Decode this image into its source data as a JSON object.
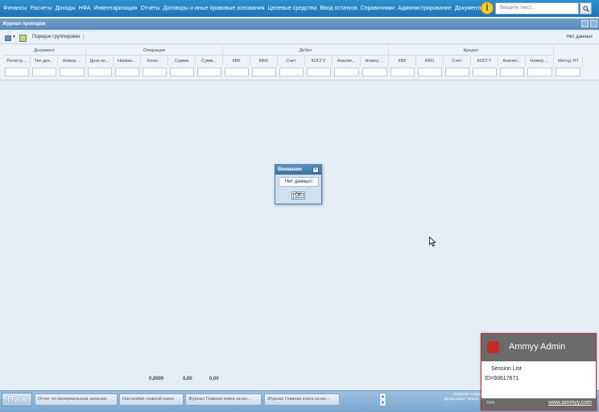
{
  "top_menu": [
    "Финансы",
    "Расчеты",
    "Доходы",
    "НФА",
    "Инвентаризация",
    "Отчеты",
    "Договоры и иные правовые основания",
    "Целевые средства",
    "Ввод остатков",
    "Справочники",
    "Администрирование",
    "Документы"
  ],
  "search": {
    "placeholder": "Введите текст..."
  },
  "window": {
    "title": "Журнал проводок"
  },
  "toolbar": {
    "grouping_label": "Порядок группировки",
    "status": "Нет данных"
  },
  "grid": {
    "groups": [
      "Документ",
      "Операция",
      "Дебет",
      "Кредит"
    ],
    "columns": [
      "Регистр...",
      "Тип док...",
      "Номер ...",
      "Дата оп...",
      "Назван...",
      "Коли...",
      "Сумма",
      "Сумм...",
      "КБК",
      "КФО",
      "Счет",
      "КОСГУ",
      "Аналит...",
      "Номер ...",
      "КБК",
      "КФО",
      "Счет",
      "КОСГУ",
      "Аналит...",
      "Номер ...",
      "Метод УП"
    ],
    "totals": [
      "0,0000",
      "0,00",
      "0,00"
    ]
  },
  "dialog": {
    "title": "Внимание",
    "message": "Нет данных!",
    "ok_label": "OK"
  },
  "taskbar": {
    "start_label": "Пуск",
    "tasks": [
      "Отчет по материальным запасам",
      "Настройки главной книги",
      "Журнал Главная книга за ме...",
      "Журнал Главная книга за ме..."
    ],
    "license_line1": "Лицензия номер",
    "license_line2": "Департамент Финан..."
  },
  "ammyy": {
    "title": "Ammyy Admin",
    "session_label": "Session List",
    "id_label": "ID=93617871",
    "arrows": ">>>",
    "link": "www.ammyy.com"
  },
  "colors": {
    "menu_bar": "#1f74b5",
    "window_title": "#5a8ab6",
    "ammyy_border": "#c62828",
    "ammyy_gray": "#6a6a6a"
  }
}
